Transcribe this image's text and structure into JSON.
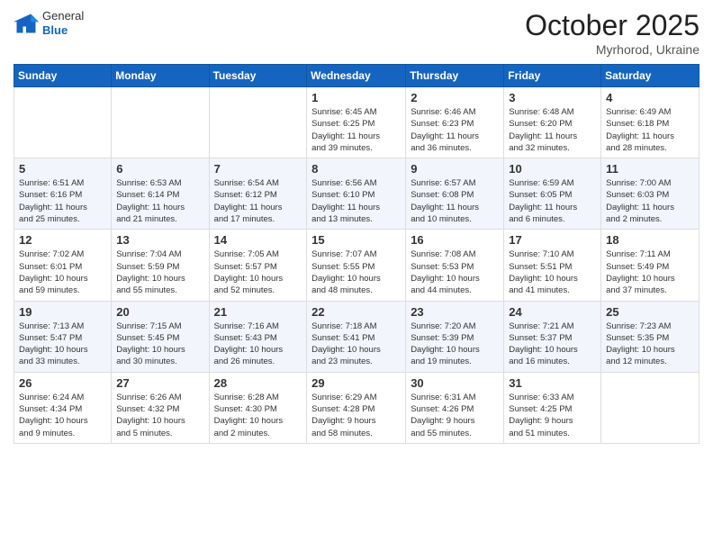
{
  "header": {
    "logo_line1": "General",
    "logo_line2": "Blue",
    "month": "October 2025",
    "location": "Myrhorod, Ukraine"
  },
  "weekdays": [
    "Sunday",
    "Monday",
    "Tuesday",
    "Wednesday",
    "Thursday",
    "Friday",
    "Saturday"
  ],
  "weeks": [
    [
      {
        "day": "",
        "info": ""
      },
      {
        "day": "",
        "info": ""
      },
      {
        "day": "",
        "info": ""
      },
      {
        "day": "1",
        "info": "Sunrise: 6:45 AM\nSunset: 6:25 PM\nDaylight: 11 hours\nand 39 minutes."
      },
      {
        "day": "2",
        "info": "Sunrise: 6:46 AM\nSunset: 6:23 PM\nDaylight: 11 hours\nand 36 minutes."
      },
      {
        "day": "3",
        "info": "Sunrise: 6:48 AM\nSunset: 6:20 PM\nDaylight: 11 hours\nand 32 minutes."
      },
      {
        "day": "4",
        "info": "Sunrise: 6:49 AM\nSunset: 6:18 PM\nDaylight: 11 hours\nand 28 minutes."
      }
    ],
    [
      {
        "day": "5",
        "info": "Sunrise: 6:51 AM\nSunset: 6:16 PM\nDaylight: 11 hours\nand 25 minutes."
      },
      {
        "day": "6",
        "info": "Sunrise: 6:53 AM\nSunset: 6:14 PM\nDaylight: 11 hours\nand 21 minutes."
      },
      {
        "day": "7",
        "info": "Sunrise: 6:54 AM\nSunset: 6:12 PM\nDaylight: 11 hours\nand 17 minutes."
      },
      {
        "day": "8",
        "info": "Sunrise: 6:56 AM\nSunset: 6:10 PM\nDaylight: 11 hours\nand 13 minutes."
      },
      {
        "day": "9",
        "info": "Sunrise: 6:57 AM\nSunset: 6:08 PM\nDaylight: 11 hours\nand 10 minutes."
      },
      {
        "day": "10",
        "info": "Sunrise: 6:59 AM\nSunset: 6:05 PM\nDaylight: 11 hours\nand 6 minutes."
      },
      {
        "day": "11",
        "info": "Sunrise: 7:00 AM\nSunset: 6:03 PM\nDaylight: 11 hours\nand 2 minutes."
      }
    ],
    [
      {
        "day": "12",
        "info": "Sunrise: 7:02 AM\nSunset: 6:01 PM\nDaylight: 10 hours\nand 59 minutes."
      },
      {
        "day": "13",
        "info": "Sunrise: 7:04 AM\nSunset: 5:59 PM\nDaylight: 10 hours\nand 55 minutes."
      },
      {
        "day": "14",
        "info": "Sunrise: 7:05 AM\nSunset: 5:57 PM\nDaylight: 10 hours\nand 52 minutes."
      },
      {
        "day": "15",
        "info": "Sunrise: 7:07 AM\nSunset: 5:55 PM\nDaylight: 10 hours\nand 48 minutes."
      },
      {
        "day": "16",
        "info": "Sunrise: 7:08 AM\nSunset: 5:53 PM\nDaylight: 10 hours\nand 44 minutes."
      },
      {
        "day": "17",
        "info": "Sunrise: 7:10 AM\nSunset: 5:51 PM\nDaylight: 10 hours\nand 41 minutes."
      },
      {
        "day": "18",
        "info": "Sunrise: 7:11 AM\nSunset: 5:49 PM\nDaylight: 10 hours\nand 37 minutes."
      }
    ],
    [
      {
        "day": "19",
        "info": "Sunrise: 7:13 AM\nSunset: 5:47 PM\nDaylight: 10 hours\nand 33 minutes."
      },
      {
        "day": "20",
        "info": "Sunrise: 7:15 AM\nSunset: 5:45 PM\nDaylight: 10 hours\nand 30 minutes."
      },
      {
        "day": "21",
        "info": "Sunrise: 7:16 AM\nSunset: 5:43 PM\nDaylight: 10 hours\nand 26 minutes."
      },
      {
        "day": "22",
        "info": "Sunrise: 7:18 AM\nSunset: 5:41 PM\nDaylight: 10 hours\nand 23 minutes."
      },
      {
        "day": "23",
        "info": "Sunrise: 7:20 AM\nSunset: 5:39 PM\nDaylight: 10 hours\nand 19 minutes."
      },
      {
        "day": "24",
        "info": "Sunrise: 7:21 AM\nSunset: 5:37 PM\nDaylight: 10 hours\nand 16 minutes."
      },
      {
        "day": "25",
        "info": "Sunrise: 7:23 AM\nSunset: 5:35 PM\nDaylight: 10 hours\nand 12 minutes."
      }
    ],
    [
      {
        "day": "26",
        "info": "Sunrise: 6:24 AM\nSunset: 4:34 PM\nDaylight: 10 hours\nand 9 minutes."
      },
      {
        "day": "27",
        "info": "Sunrise: 6:26 AM\nSunset: 4:32 PM\nDaylight: 10 hours\nand 5 minutes."
      },
      {
        "day": "28",
        "info": "Sunrise: 6:28 AM\nSunset: 4:30 PM\nDaylight: 10 hours\nand 2 minutes."
      },
      {
        "day": "29",
        "info": "Sunrise: 6:29 AM\nSunset: 4:28 PM\nDaylight: 9 hours\nand 58 minutes."
      },
      {
        "day": "30",
        "info": "Sunrise: 6:31 AM\nSunset: 4:26 PM\nDaylight: 9 hours\nand 55 minutes."
      },
      {
        "day": "31",
        "info": "Sunrise: 6:33 AM\nSunset: 4:25 PM\nDaylight: 9 hours\nand 51 minutes."
      },
      {
        "day": "",
        "info": ""
      }
    ]
  ]
}
